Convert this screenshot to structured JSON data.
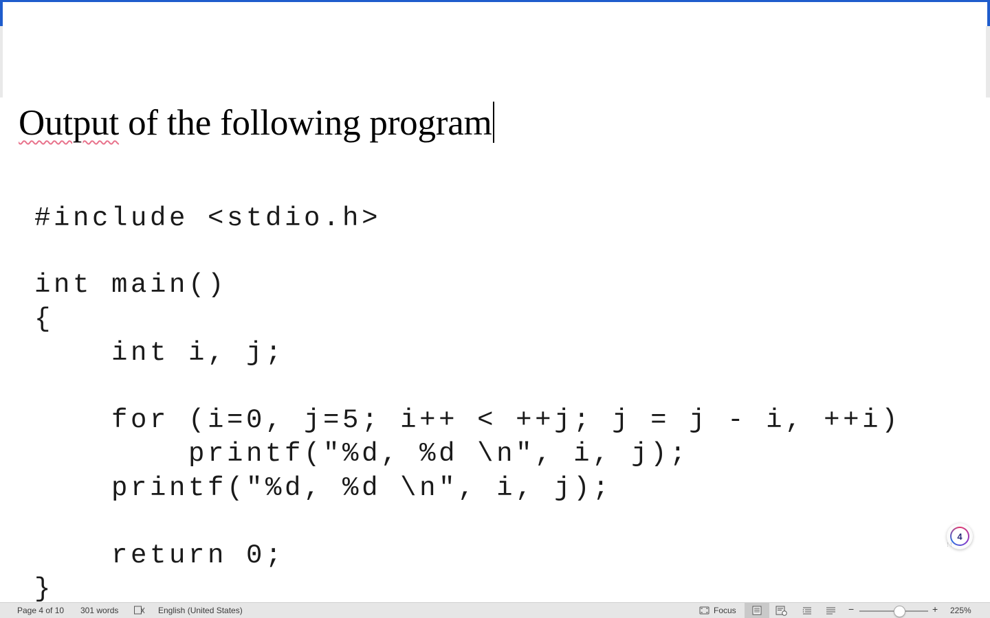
{
  "document": {
    "heading_part1": "Output",
    "heading_part2": " of the following program",
    "code_lines": [
      "#include <stdio.h>",
      "int main()",
      "{",
      "    int i, j;",
      "    for (i=0, j=5; i++ < ++j; j = j - i, ++i)",
      "        printf(\"%d, %d \\n\", i, j);",
      "    printf(\"%d, %d \\n\", i, j);",
      "    return 0;",
      "}"
    ]
  },
  "badge": {
    "count": "4"
  },
  "status_bar": {
    "page_info": "Page 4 of 10",
    "word_count": "301 words",
    "language": "English (United States)",
    "focus_label": "Focus",
    "zoom": "225%",
    "zoom_minus": "−",
    "zoom_plus": "+",
    "zoom_level_fraction": 0.58
  },
  "icons": {
    "proofing": "proofing-icon",
    "focus": "focus-icon",
    "print_layout": "print-layout-icon",
    "web_layout": "web-layout-icon",
    "outline": "outline-icon",
    "draft": "draft-icon"
  },
  "colors": {
    "accent_border": "#1f5ccc",
    "spell_underline": "#e8738c",
    "status_bar_bg": "#e6e6e6"
  }
}
